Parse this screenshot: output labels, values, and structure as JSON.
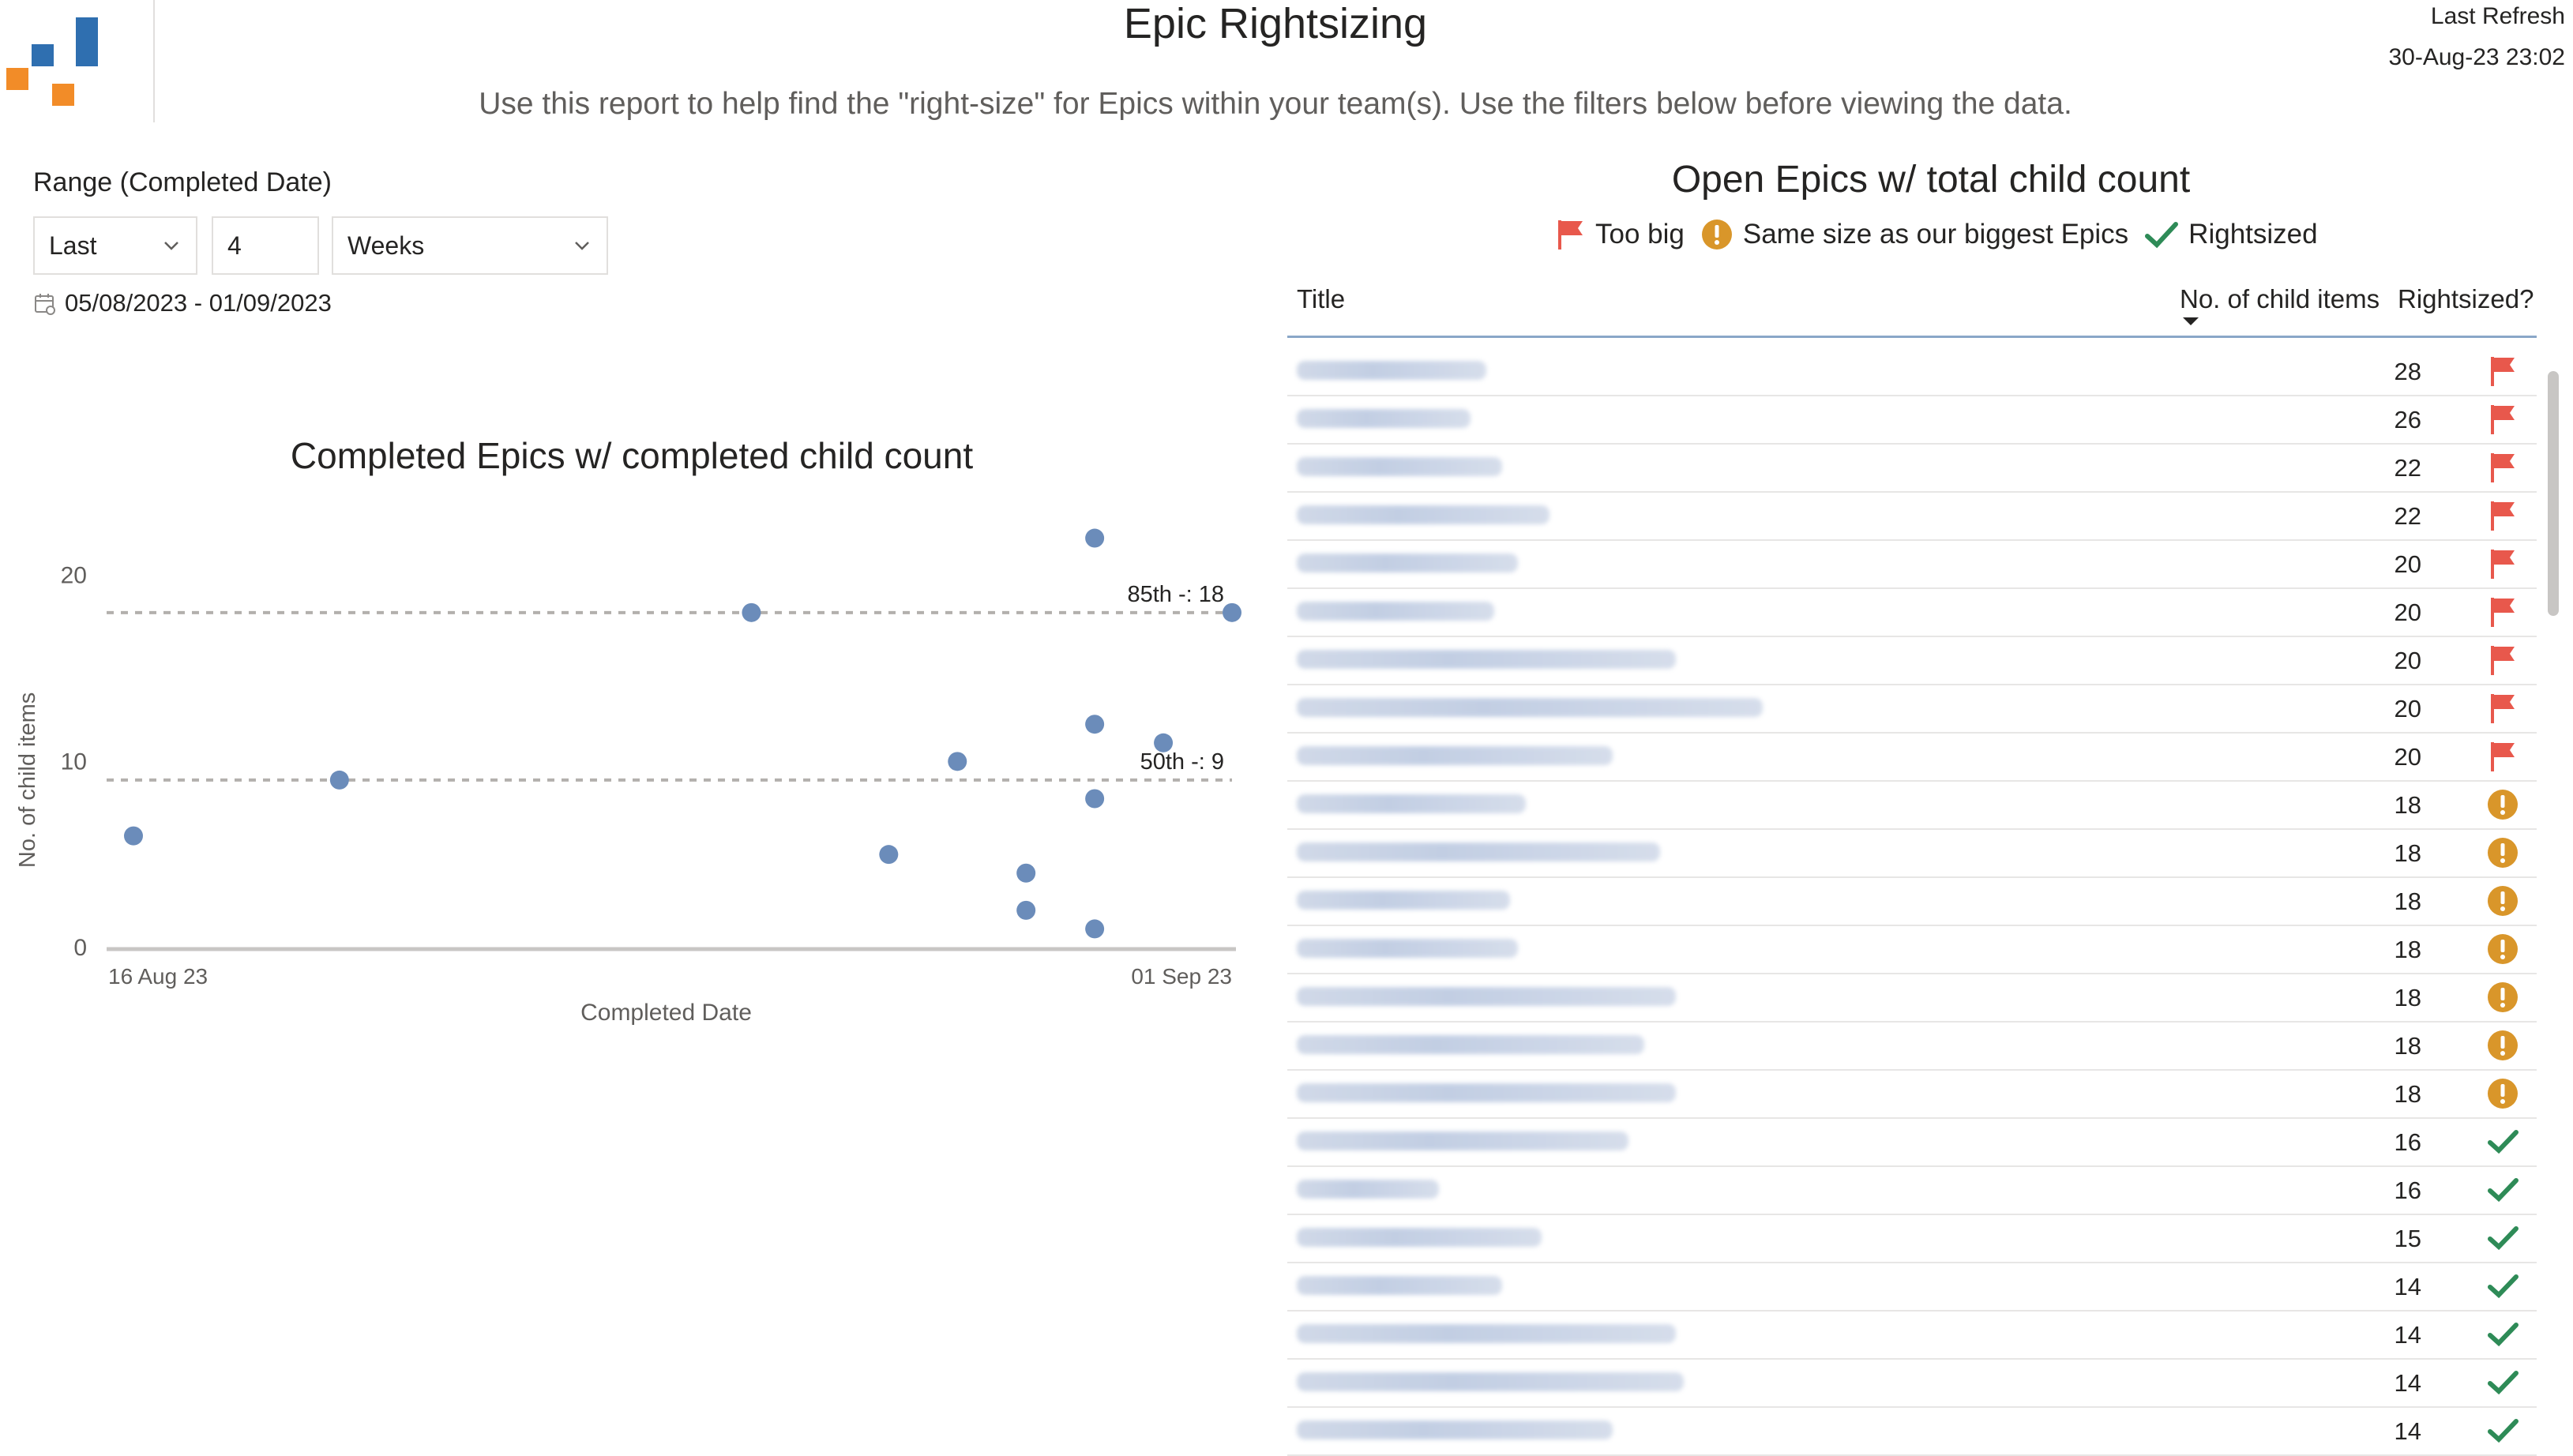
{
  "header": {
    "title": "Epic Rightsizing",
    "subtitle": "Use this report to help find the \"right-size\" for Epics within your team(s). Use the filters below before viewing the data.",
    "refresh_label": "Last Refresh",
    "refresh_value": "30-Aug-23 23:02"
  },
  "filters": {
    "range_label": "Range (Completed Date)",
    "period_value": "Last",
    "count_value": "4",
    "unit_value": "Weeks",
    "date_range": "05/08/2023 - 01/09/2023"
  },
  "scatter": {
    "title": "Completed Epics w/ completed child count",
    "ylabel": "No. of child items",
    "xlabel": "Completed Date",
    "x_start_label": "16 Aug 23",
    "x_end_label": "01 Sep 23",
    "y_ticks": [
      "0",
      "10",
      "20"
    ],
    "p85_label": "85th -: 18",
    "p50_label": "50th -: 9"
  },
  "chart_data": {
    "type": "scatter",
    "title": "Completed Epics w/ completed child count",
    "xlabel": "Completed Date",
    "ylabel": "No. of child items",
    "x_range": [
      "2023-08-16",
      "2023-09-01"
    ],
    "ylim": [
      0,
      22
    ],
    "point_color": "#6b8cba",
    "points": [
      {
        "x": "2023-08-16",
        "y": 6
      },
      {
        "x": "2023-08-19",
        "y": 9
      },
      {
        "x": "2023-08-25",
        "y": 18
      },
      {
        "x": "2023-08-27",
        "y": 5
      },
      {
        "x": "2023-08-28",
        "y": 10
      },
      {
        "x": "2023-08-29",
        "y": 4
      },
      {
        "x": "2023-08-29",
        "y": 2
      },
      {
        "x": "2023-08-30",
        "y": 1
      },
      {
        "x": "2023-08-30",
        "y": 22
      },
      {
        "x": "2023-08-30",
        "y": 12
      },
      {
        "x": "2023-08-30",
        "y": 8
      },
      {
        "x": "2023-08-31",
        "y": 11
      },
      {
        "x": "2023-09-01",
        "y": 18
      }
    ],
    "reference_lines": [
      {
        "label": "85th -: 18",
        "y": 18
      },
      {
        "label": "50th -: 9",
        "y": 9
      }
    ],
    "grid": false
  },
  "table": {
    "title": "Open Epics w/ total child count",
    "legend": {
      "too_big": "Too big",
      "same_size": "Same size as our biggest Epics",
      "rightsized": "Rightsized"
    },
    "columns": {
      "title": "Title",
      "count": "No. of child items",
      "status": "Rightsized?"
    },
    "colors": {
      "flag": "#e8584c",
      "warning": "#d9962a",
      "check": "#2e8b57"
    },
    "rows": [
      {
        "count": "28",
        "status": "flag"
      },
      {
        "count": "26",
        "status": "flag"
      },
      {
        "count": "22",
        "status": "flag"
      },
      {
        "count": "22",
        "status": "flag"
      },
      {
        "count": "20",
        "status": "flag"
      },
      {
        "count": "20",
        "status": "flag"
      },
      {
        "count": "20",
        "status": "flag"
      },
      {
        "count": "20",
        "status": "flag"
      },
      {
        "count": "20",
        "status": "flag"
      },
      {
        "count": "18",
        "status": "warning"
      },
      {
        "count": "18",
        "status": "warning"
      },
      {
        "count": "18",
        "status": "warning"
      },
      {
        "count": "18",
        "status": "warning"
      },
      {
        "count": "18",
        "status": "warning"
      },
      {
        "count": "18",
        "status": "warning"
      },
      {
        "count": "18",
        "status": "warning"
      },
      {
        "count": "16",
        "status": "check"
      },
      {
        "count": "16",
        "status": "check"
      },
      {
        "count": "15",
        "status": "check"
      },
      {
        "count": "14",
        "status": "check"
      },
      {
        "count": "14",
        "status": "check"
      },
      {
        "count": "14",
        "status": "check"
      },
      {
        "count": "14",
        "status": "check"
      }
    ]
  }
}
